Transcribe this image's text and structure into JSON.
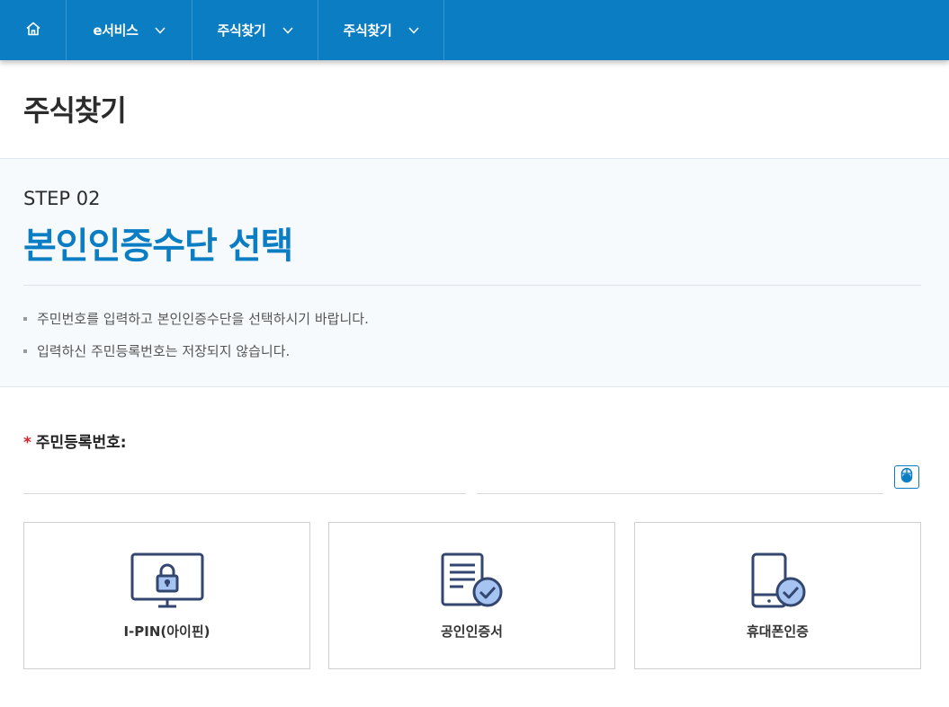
{
  "nav": {
    "home_icon": "home-icon",
    "items": [
      {
        "label": "e서비스"
      },
      {
        "label": "주식찾기"
      },
      {
        "label": "주식찾기"
      }
    ]
  },
  "page_title": "주식찾기",
  "step": {
    "label": "STEP 02",
    "heading": "본인인증수단 선택",
    "notes": [
      "주민번호를 입력하고 본인인증수단을 선택하시기 바랍니다.",
      "입력하신 주민등록번호는 저장되지 않습니다."
    ]
  },
  "form": {
    "required_mark": "*",
    "rrn_label": "주민등록번호:",
    "rrn_first_value": "",
    "rrn_second_value": "",
    "mouse_icon": "mouse-icon"
  },
  "auth_methods": [
    {
      "label": "I-PIN(아이핀)",
      "icon": "monitor-lock-icon"
    },
    {
      "label": "공인인증서",
      "icon": "certificate-check-icon"
    },
    {
      "label": "휴대폰인증",
      "icon": "phone-check-icon"
    }
  ],
  "colors": {
    "brand": "#0b7dc2",
    "required": "#d6202a",
    "icon_stroke": "#33466f",
    "icon_fill": "#a6c4f2"
  }
}
